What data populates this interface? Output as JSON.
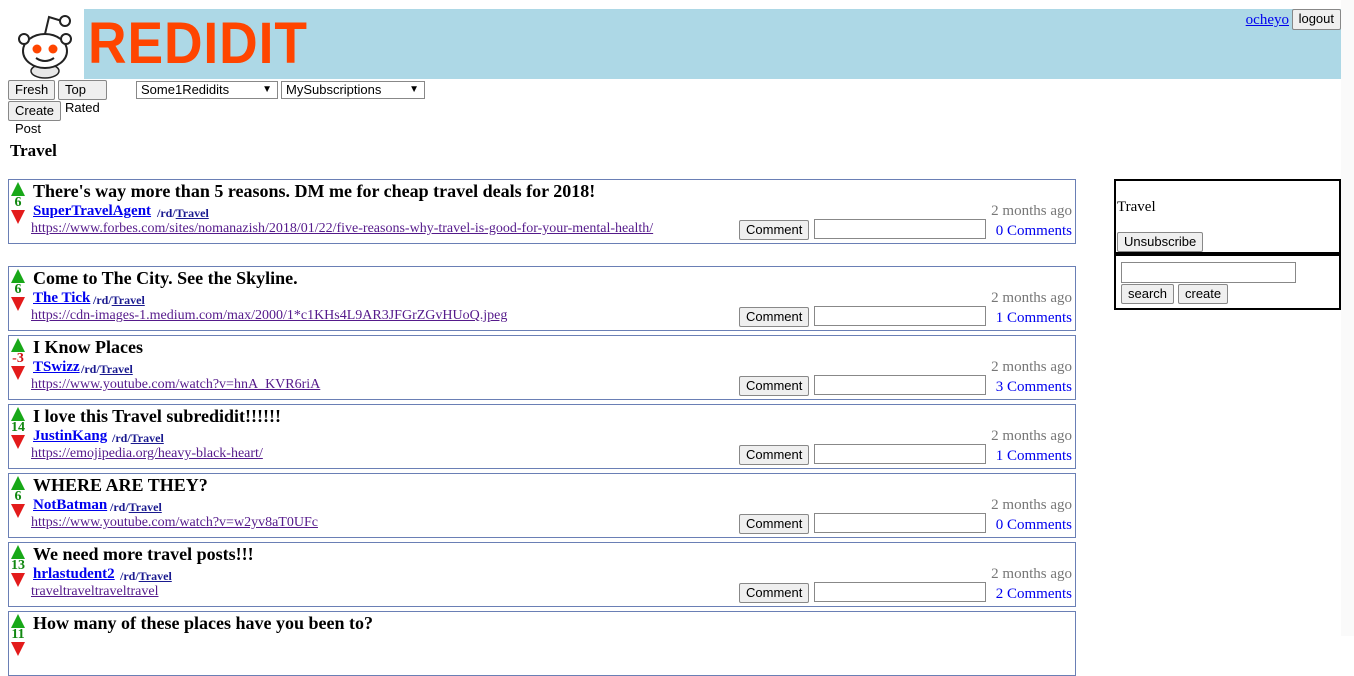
{
  "header": {
    "logo_text": "REDIDIT",
    "user": "ocheyo",
    "logout_label": "logout",
    "bg_color": "#add8e6",
    "logo_color": "#ff4500"
  },
  "toolbar": {
    "fresh_label": "Fresh",
    "top_rated_label": "Top Rated",
    "subreddit_select": "Some1Redidits",
    "subscriptions_select": "MySubscriptions",
    "create_post_label": "Create Post"
  },
  "section_title": "Travel",
  "posts": [
    {
      "score": "6",
      "title": "There's way more than 5 reasons. DM me for cheap travel deals for 2018!",
      "author": "SuperTravelAgent",
      "sub_prefix": "/rd/",
      "sub_name": "Travel",
      "age": "2 months ago",
      "link": "https://www.forbes.com/sites/nomanazish/2018/01/22/five-reasons-why-travel-is-good-for-your-mental-health/",
      "comment_label": "Comment",
      "comments": "0 Comments"
    },
    {
      "score": "6",
      "title": "Come to The City. See the Skyline.",
      "author": "The Tick",
      "sub_prefix": "/rd/",
      "sub_name": "Travel",
      "age": "2 months ago",
      "link": "https://cdn-images-1.medium.com/max/2000/1*c1KHs4L9AR3JFGrZGvHUoQ.jpeg",
      "comment_label": "Comment",
      "comments": "1 Comments"
    },
    {
      "score": "-3",
      "title": "I Know Places",
      "author": "TSwizz",
      "sub_prefix": "/rd/",
      "sub_name": "Travel",
      "age": "2 months ago",
      "link": "https://www.youtube.com/watch?v=hnA_KVR6riA",
      "comment_label": "Comment",
      "comments": "3 Comments"
    },
    {
      "score": "14",
      "title": "I love this Travel subredidit!!!!!!",
      "author": "JustinKang",
      "sub_prefix": "/rd/",
      "sub_name": "Travel",
      "age": "2 months ago",
      "link": "https://emojipedia.org/heavy-black-heart/",
      "comment_label": "Comment",
      "comments": "1 Comments"
    },
    {
      "score": "6",
      "title": "WHERE ARE THEY?",
      "author": "NotBatman",
      "sub_prefix": "/rd/",
      "sub_name": "Travel",
      "age": "2 months ago",
      "link": "https://www.youtube.com/watch?v=w2yv8aT0UFc",
      "comment_label": "Comment",
      "comments": "0 Comments"
    },
    {
      "score": "13",
      "title": "We need more travel posts!!!",
      "author": "hrlastudent2",
      "sub_prefix": "/rd/",
      "sub_name": "Travel",
      "age": "2 months ago",
      "link": "traveltraveltraveltravel",
      "comment_label": "Comment",
      "comments": "2 Comments"
    },
    {
      "score": "11",
      "title": "How many of these places have you been to?",
      "author": "",
      "sub_prefix": "",
      "sub_name": "",
      "age": "",
      "link": "",
      "comment_label": "",
      "comments": ""
    }
  ],
  "sidebar": {
    "title": "Travel",
    "unsubscribe_label": "Unsubscribe",
    "search_label": "search",
    "create_label": "create"
  }
}
